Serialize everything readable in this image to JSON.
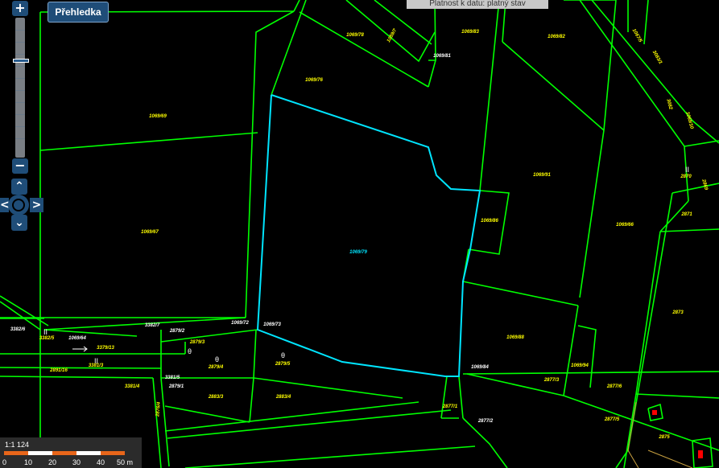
{
  "toolbar": {
    "overview_label": "Přehledka"
  },
  "zoom": {
    "plus_label": "+",
    "minus_label": "−"
  },
  "pan": {
    "up": "⌃",
    "down": "⌄",
    "left": "<",
    "right": ">"
  },
  "validity": {
    "text": "Platnost k datu: platný stav"
  },
  "scale": {
    "ratio": "1:1 124",
    "ticks": [
      "0",
      "10",
      "20",
      "30",
      "40",
      "50 m"
    ],
    "colors": {
      "dark": "#e8661a",
      "light": "#ffffff"
    }
  },
  "colors": {
    "parcel_line": "#00ff00",
    "selected_parcel": "#00e5ff",
    "label": "#ffff00",
    "background": "#000000"
  },
  "parcels": [
    "1069/69",
    "1069/78",
    "1059/7",
    "1069/83",
    "1069/81",
    "1069/82",
    "1069/76",
    "1069/67",
    "1069/79",
    "1069/91",
    "1069/86",
    "1069/66",
    "1069/88",
    "1069/84",
    "1069/73",
    "1069/72",
    "1069/64",
    "1069/94",
    "3382/6",
    "3382/5",
    "3382/7",
    "3379/13",
    "3381/3",
    "3381/5",
    "3381/4",
    "2891/16",
    "2879/2",
    "2879/3",
    "2879/4",
    "2879/5",
    "2879/1",
    "2883/3",
    "2883/4",
    "2877/1",
    "2877/2",
    "2877/3",
    "2877/6",
    "2877/5",
    "2870",
    "2871",
    "2873",
    "2875",
    "2869",
    "1069/10",
    "1067/5",
    "3082",
    "3083/1",
    "2876/4"
  ]
}
